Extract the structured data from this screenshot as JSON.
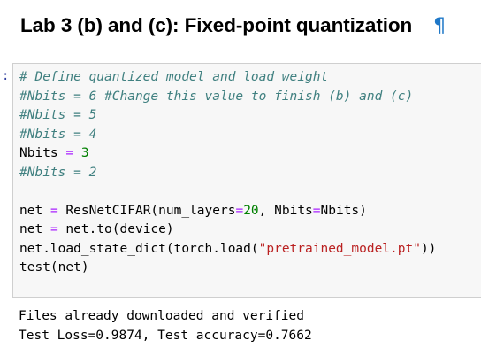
{
  "heading": {
    "title": "Lab 3 (b) and (c): Fixed-point quantization",
    "anchor": "¶"
  },
  "cell": {
    "prompt": ":",
    "code": {
      "l1": "# Define quantized model and load weight",
      "l2": "#Nbits = 6 #Change this value to finish (b) and (c)",
      "l3": "#Nbits = 5",
      "l4": "#Nbits = 4",
      "l5": {
        "var": "Nbits",
        "op": "=",
        "num": "3"
      },
      "l6": "#Nbits = 2",
      "l8": {
        "var": "net",
        "op": "=",
        "call": "ResNetCIFAR(num_layers",
        "eq1": "=",
        "num": "20",
        "mid": ", Nbits",
        "eq2": "=",
        "end": "Nbits)"
      },
      "l9": {
        "var": "net",
        "op": "=",
        "rest": "net.to(device)"
      },
      "l10": {
        "pre": "net.load_state_dict(torch.load(",
        "str": "\"pretrained_model.pt\"",
        "post": "))"
      },
      "l11": "test(net)"
    }
  },
  "output": {
    "line1": "Files already downloaded and verified",
    "line2": "Test Loss=0.9874, Test accuracy=0.7662"
  },
  "colors": {
    "comment": "#408080",
    "operator": "#aa22ff",
    "number": "#008000",
    "string": "#ba2121",
    "anchor": "#1f78c8",
    "cell_bg": "#f7f7f7",
    "cell_border": "#cfcfcf"
  }
}
